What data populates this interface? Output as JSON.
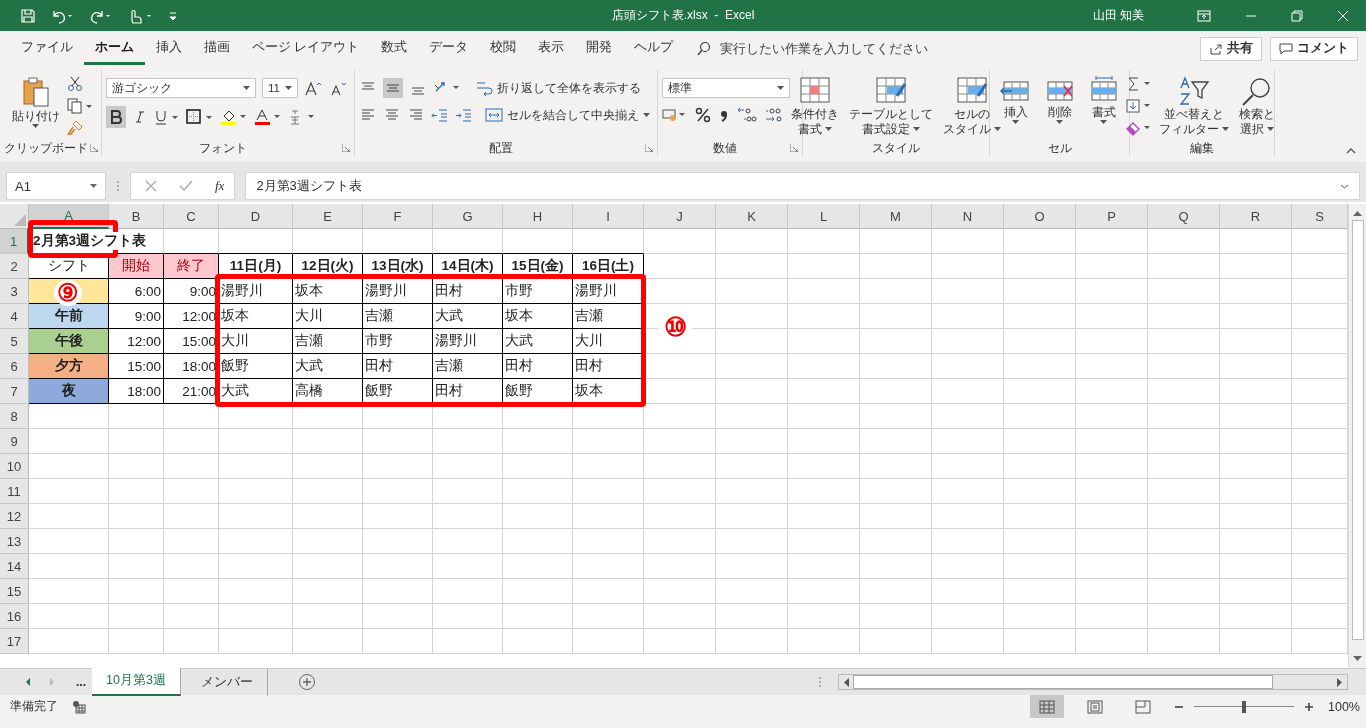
{
  "window": {
    "title": "店頭シフト表.xlsx  -  Excel",
    "user": "山田 知美"
  },
  "ribbon_tabs": [
    {
      "label": "ファイル",
      "selected": false
    },
    {
      "label": "ホーム",
      "selected": true
    },
    {
      "label": "挿入",
      "selected": false
    },
    {
      "label": "描画",
      "selected": false
    },
    {
      "label": "ページ レイアウト",
      "selected": false
    },
    {
      "label": "数式",
      "selected": false
    },
    {
      "label": "データ",
      "selected": false
    },
    {
      "label": "校閲",
      "selected": false
    },
    {
      "label": "表示",
      "selected": false
    },
    {
      "label": "開発",
      "selected": false
    },
    {
      "label": "ヘルプ",
      "selected": false
    }
  ],
  "tell_me": {
    "placeholder": "実行したい作業を入力してください"
  },
  "share": "共有",
  "comment": "コメント",
  "ribbon": {
    "clipboard": {
      "paste": "貼り付け",
      "label": "クリップボード"
    },
    "font": {
      "font_name": "游ゴシック",
      "font_size": "11",
      "label": "フォント"
    },
    "alignment": {
      "wrap_text": "折り返して全体を表示する",
      "merge": "セルを結合して中央揃え",
      "label": "配置"
    },
    "number": {
      "format": "標準",
      "label": "数値"
    },
    "styles": {
      "buttons": [
        [
          "条件付き",
          "書式"
        ],
        [
          "テーブルとして",
          "書式設定"
        ],
        [
          "セルの",
          "スタイル"
        ]
      ],
      "label": "スタイル"
    },
    "cells": {
      "buttons": [
        "挿入",
        "削除",
        "書式"
      ],
      "label": "セル"
    },
    "editing": {
      "buttons": [
        [
          "並べ替えと",
          "フィルター"
        ],
        [
          "検索と",
          "選択"
        ]
      ],
      "label": "編集"
    }
  },
  "formula_bar": {
    "name_box": "A1",
    "fx": "fx",
    "formula": "2月第3週シフト表"
  },
  "sheet": {
    "columns": [
      "A",
      "B",
      "C",
      "D",
      "E",
      "F",
      "G",
      "H",
      "I",
      "J",
      "K",
      "L",
      "M",
      "N",
      "O",
      "P",
      "Q",
      "R",
      "S"
    ],
    "rows": [
      "1",
      "2",
      "3",
      "4",
      "5",
      "6",
      "7",
      "8",
      "9",
      "10",
      "11",
      "12",
      "13",
      "14",
      "15",
      "16",
      "17"
    ],
    "title": "2月第3週シフト表",
    "header": {
      "shift": "シフト",
      "start": "開始",
      "end": "終了",
      "days": [
        "11日(月)",
        "12日(火)",
        "13日(水)",
        "14日(木)",
        "15日(金)",
        "16日(土)"
      ]
    },
    "shifts": [
      {
        "color": "#ffe699",
        "start": "6:00",
        "end": "9:00",
        "staff": [
          "湯野川",
          "坂本",
          "湯野川",
          "田村",
          "市野",
          "湯野川"
        ]
      },
      {
        "name": "午前",
        "color": "#bdd7ee",
        "start": "9:00",
        "end": "12:00",
        "staff": [
          "坂本",
          "大川",
          "吉瀬",
          "大武",
          "坂本",
          "吉瀬"
        ]
      },
      {
        "name": "午後",
        "color": "#a9d08e",
        "start": "12:00",
        "end": "15:00",
        "staff": [
          "大川",
          "吉瀬",
          "市野",
          "湯野川",
          "大武",
          "大川"
        ]
      },
      {
        "name": "夕方",
        "color": "#f4b084",
        "start": "15:00",
        "end": "18:00",
        "staff": [
          "飯野",
          "大武",
          "田村",
          "吉瀬",
          "田村",
          "田村"
        ]
      },
      {
        "name": "夜",
        "color": "#8ea9db",
        "start": "18:00",
        "end": "21:00",
        "staff": [
          "大武",
          "高橋",
          "飯野",
          "田村",
          "飯野",
          "坂本"
        ]
      }
    ]
  },
  "annotations": [
    {
      "label": "⑨"
    },
    {
      "label": "⑩"
    }
  ],
  "sheet_tabs": {
    "overflow": "...",
    "tabs": [
      {
        "label": "10月第3週",
        "selected": true
      },
      {
        "label": "メンバー",
        "selected": false
      }
    ]
  },
  "status_bar": {
    "text": "準備完了",
    "zoom": "100%",
    "zoom_level": {
      "level": 0.5
    }
  }
}
